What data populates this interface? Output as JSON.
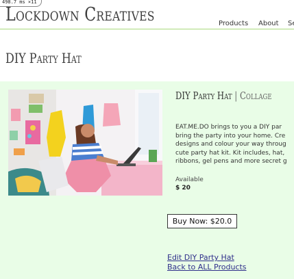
{
  "perf": {
    "text": "498.7 ms ×11"
  },
  "site": {
    "title": "Lockdown Creatives"
  },
  "nav": {
    "items": [
      "Products",
      "About",
      "Se"
    ]
  },
  "page": {
    "title": "DIY Party Hat"
  },
  "product": {
    "name": "DIY Party Hat",
    "separator": " | ",
    "category": "Collage",
    "description_lines": [
      "EAT.ME.DO brings to you a DIY par",
      "bring the party into your home. Cre",
      "designs and colour your way throug",
      "cute party hat kit. Kit includes, hat,",
      "ribbons, gel pens and more secret g"
    ],
    "availability_label": "Available",
    "price": "$ 20"
  },
  "actions": {
    "buy_label": "Buy Now: $20.0",
    "edit_label": "Edit DIY Party Hat",
    "back_label": "Back to ALL Products"
  },
  "colors": {
    "panel_bg": "#e9fde7",
    "header_rule": "#a8d97a",
    "link": "#2e2e8a"
  }
}
